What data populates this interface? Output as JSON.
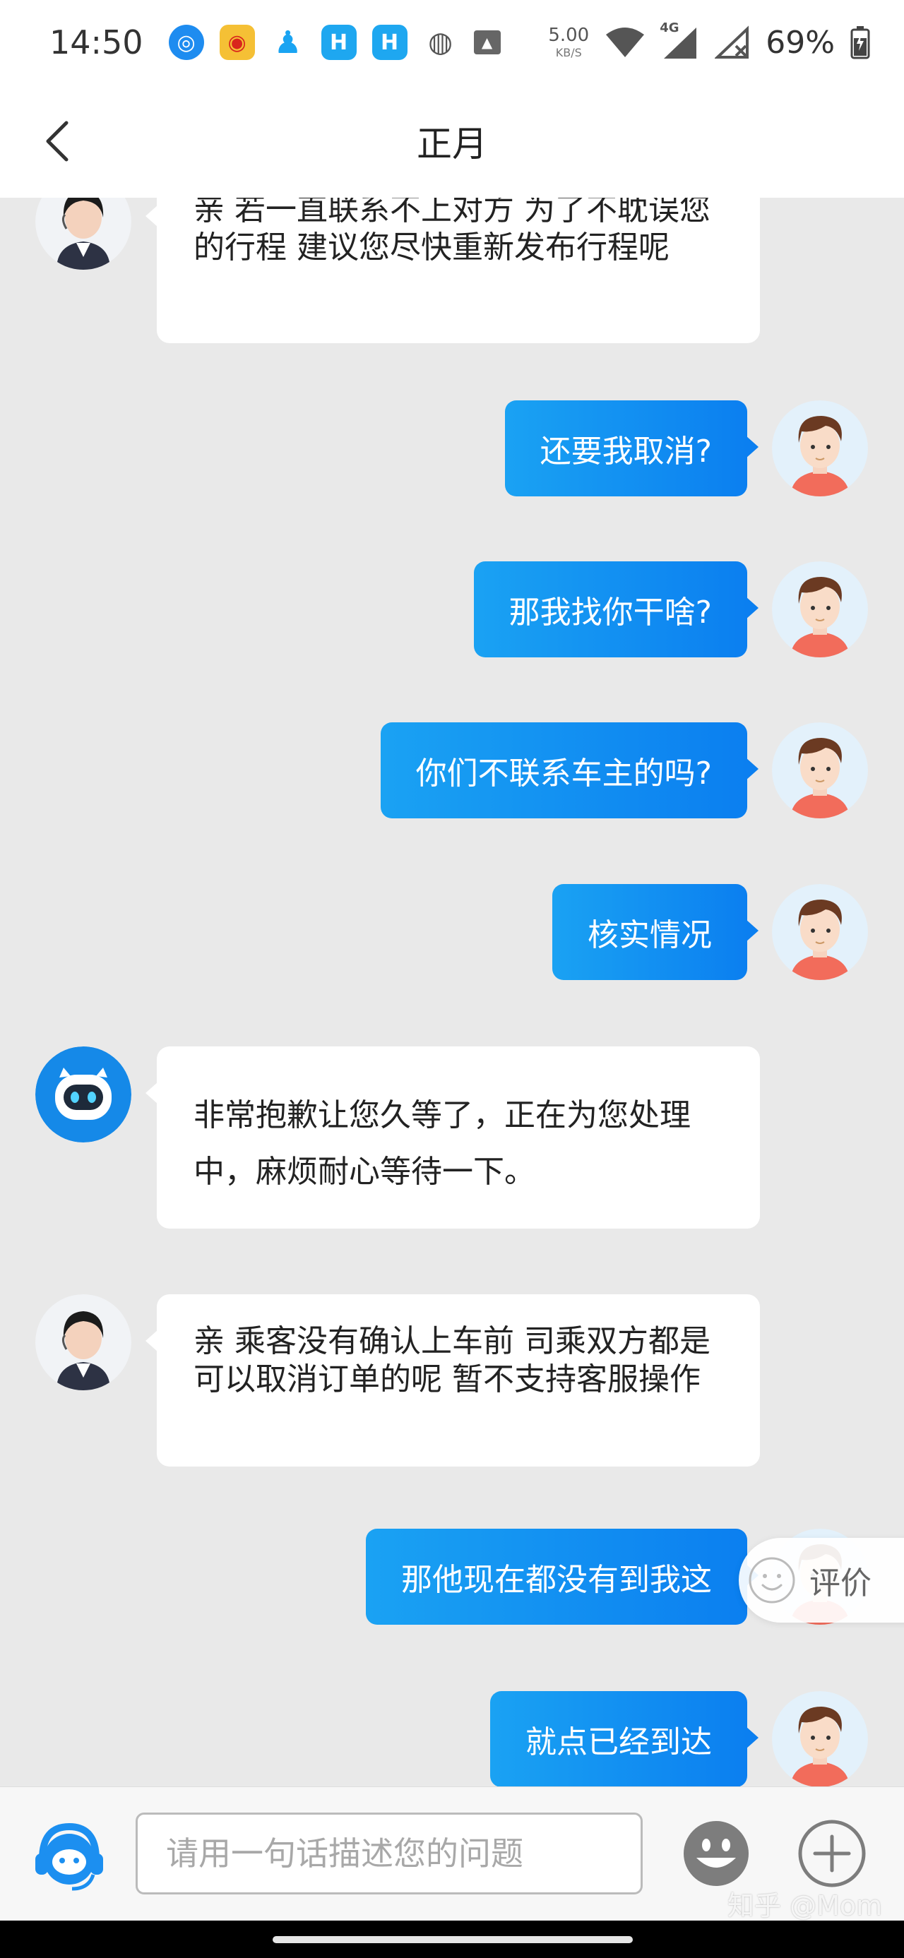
{
  "status_bar": {
    "time": "14:50",
    "net_speed": "5.00",
    "net_unit": "KB/S",
    "signal_label": "4G",
    "battery": "69%"
  },
  "header": {
    "title": "正月"
  },
  "messages": [
    {
      "side": "left",
      "sender": "agent",
      "text": "亲 若一直联系不上对方 为了不耽误您的行程 建议您尽快重新发布行程呢"
    },
    {
      "side": "right",
      "sender": "user",
      "text": "还要我取消?"
    },
    {
      "side": "right",
      "sender": "user",
      "text": "那我找你干啥?"
    },
    {
      "side": "right",
      "sender": "user",
      "text": "你们不联系车主的吗?"
    },
    {
      "side": "right",
      "sender": "user",
      "text": "核实情况"
    },
    {
      "side": "left",
      "sender": "bot",
      "text": "非常抱歉让您久等了，正在为您处理中，麻烦耐心等待一下。"
    },
    {
      "side": "left",
      "sender": "agent",
      "text": "亲 乘客没有确认上车前 司乘双方都是可以取消订单的呢 暂不支持客服操作"
    },
    {
      "side": "right",
      "sender": "user",
      "text": "那他现在都没有到我这"
    },
    {
      "side": "right",
      "sender": "user",
      "text": "就点已经到达"
    }
  ],
  "rate_button": {
    "label": "评价"
  },
  "input": {
    "placeholder": "请用一句话描述您的问题"
  },
  "watermark": "知乎 @Mom",
  "colors": {
    "accent": "#0b7ff0",
    "accent_light": "#1aa2f3",
    "background": "#e9e9e9"
  }
}
